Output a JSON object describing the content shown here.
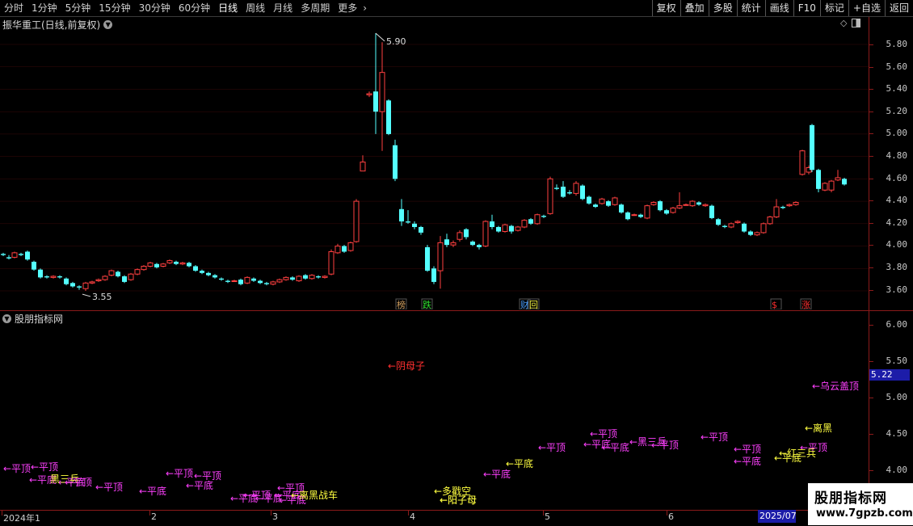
{
  "toolbar": {
    "periods": [
      "分时",
      "1分钟",
      "5分钟",
      "15分钟",
      "30分钟",
      "60分钟",
      "日线",
      "周线",
      "月线",
      "多周期",
      "更多"
    ],
    "active_period": "日线",
    "more_arrow": "›",
    "actions": [
      "复权",
      "叠加",
      "多股",
      "统计",
      "画线",
      "F10",
      "标记",
      "+自选",
      "返回"
    ]
  },
  "main_pane": {
    "title": "振华重工(日线,前复权)",
    "y_labels": [
      "5.80",
      "5.60",
      "5.40",
      "5.20",
      "5.00",
      "4.80",
      "4.60",
      "4.40",
      "4.20",
      "4.00",
      "3.80",
      "3.60"
    ],
    "high_label": "5.90",
    "low_label": "3.55",
    "event_markers": [
      "榜",
      "跌",
      "财",
      "回",
      "$",
      "涨"
    ]
  },
  "indicator_pane": {
    "title": "股朋指标网",
    "y_labels": [
      "6.00",
      "5.50",
      "5.00",
      "4.50",
      "4.00"
    ],
    "current_value": "5.22",
    "labels": [
      "←平顶",
      "←平顶",
      "←平底",
      "←平底",
      "←平顶",
      "黑三兵",
      "←平顶",
      "←平底",
      "←平顶",
      "←平顶",
      "←平底",
      "←平顶",
      "←平底",
      "←平底",
      "←平底",
      "←平底",
      "←平顶",
      "←离黑战车",
      "←平底",
      "←阴母子",
      "←多戳空",
      "←阳子母",
      "←平底",
      "←阳子母",
      "←平顶",
      "←平顶",
      "←平底",
      "←黑三兵",
      "←平顶",
      "←平顶",
      "←平顶",
      "←平底",
      "←平顶",
      "←平底",
      "←离黑",
      "←红三兵",
      "←平底",
      "←乌云盖顶"
    ]
  },
  "x_axis": {
    "labels": [
      "2024年1",
      "2",
      "3",
      "4",
      "5",
      "6"
    ],
    "current_date": "2025/07"
  },
  "watermark": {
    "title": "股朋指标网",
    "url": "www.7gpzb.com"
  },
  "colors": {
    "up": "#ff4040",
    "down": "#54ffff",
    "label_magenta": "#ff40ff",
    "label_yellow": "#ffff40",
    "label_red": "#ff3030",
    "axis_red": "#8b1a1a",
    "grid": "#3a0a0a"
  }
}
